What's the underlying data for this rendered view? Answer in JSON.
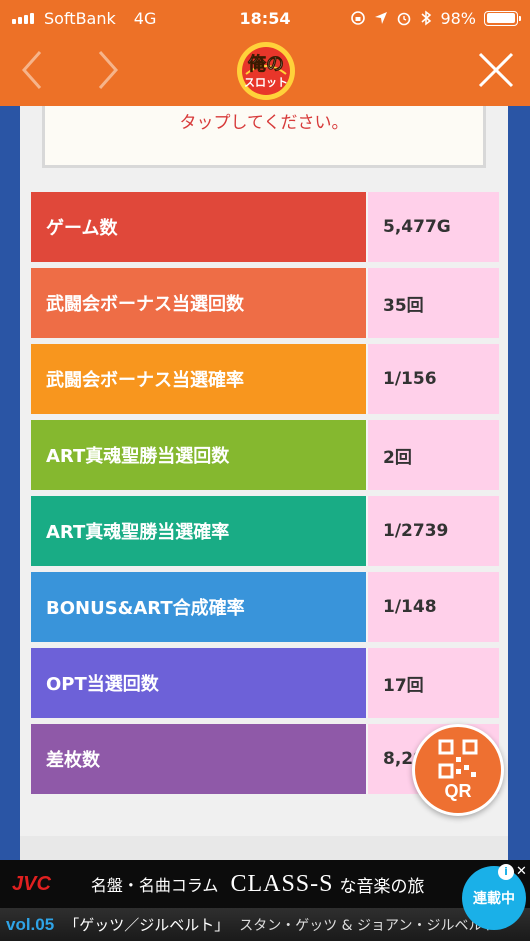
{
  "status_bar": {
    "carrier": "SoftBank",
    "network": "4G",
    "time": "18:54",
    "battery_percent": "98%",
    "battery_level": 0.98
  },
  "header": {
    "logo_text": "俺のスロット"
  },
  "notice": {
    "text": "タップしてください。"
  },
  "stats": [
    {
      "label": "ゲーム数",
      "value": "5,477G",
      "color": "#e0483a"
    },
    {
      "label": "武闘会ボーナス当選回数",
      "value": "35回",
      "color": "#ee6d46"
    },
    {
      "label": "武闘会ボーナス当選確率",
      "value": "1/156",
      "color": "#f8961e"
    },
    {
      "label": "ART真魂聖勝当選回数",
      "value": "2回",
      "color": "#85b82f"
    },
    {
      "label": "ART真魂聖勝当選確率",
      "value": "1/2739",
      "color": "#19ac85"
    },
    {
      "label": "BONUS&ART合成確率",
      "value": "1/148",
      "color": "#3994da"
    },
    {
      "label": "OPT当選回数",
      "value": "17回",
      "color": "#6d61d8"
    },
    {
      "label": "差枚数",
      "value": "8,28",
      "color": "#8f59a8"
    }
  ],
  "qr_button": {
    "label": "QR"
  },
  "ad": {
    "brand": "JVC",
    "text": "名盤・名曲コラム",
    "title": "CLASS-S",
    "suffix": "な音楽の旅",
    "vol": "vol.05",
    "song": "「ゲッツ／ジルベルト」",
    "artists": "スタン・ゲッツ & ジョアン・ジルベルト",
    "badge": "連載中"
  }
}
